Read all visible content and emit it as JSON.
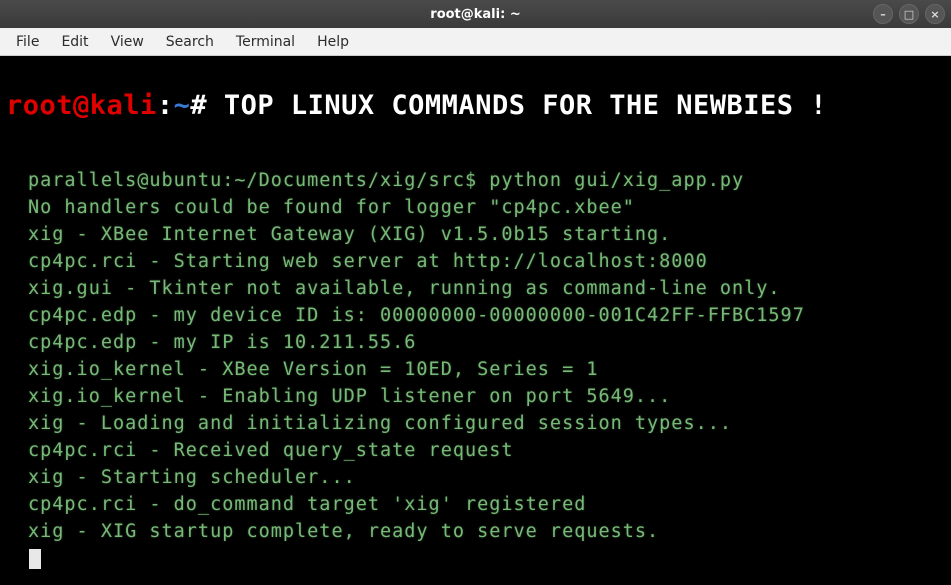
{
  "window": {
    "title": "root@kali: ~"
  },
  "menubar": {
    "items": [
      "File",
      "Edit",
      "View",
      "Search",
      "Terminal",
      "Help"
    ]
  },
  "prompt": {
    "user_host": "root@kali",
    "colon": ":",
    "path": "~",
    "symbol": "# ",
    "command": "TOP LINUX COMMANDS FOR THE NEWBIES !"
  },
  "output_lines": [
    "parallels@ubuntu:~/Documents/xig/src$ python gui/xig_app.py",
    "No handlers could be found for logger \"cp4pc.xbee\"",
    "xig - XBee Internet Gateway (XIG) v1.5.0b15 starting.",
    "cp4pc.rci - Starting web server at http://localhost:8000",
    "xig.gui - Tkinter not available, running as command-line only.",
    "cp4pc.edp - my device ID is: 00000000-00000000-001C42FF-FFBC1597",
    "cp4pc.edp - my IP is 10.211.55.6",
    "xig.io_kernel - XBee Version = 10ED, Series = 1",
    "xig.io_kernel - Enabling UDP listener on port 5649...",
    "xig - Loading and initializing configured session types...",
    "cp4pc.rci - Received query_state request",
    "xig - Starting scheduler...",
    "cp4pc.rci - do_command target 'xig' registered",
    "xig - XIG startup complete, ready to serve requests."
  ],
  "icons": {
    "minimize": "–",
    "maximize": "□",
    "close": "×"
  }
}
